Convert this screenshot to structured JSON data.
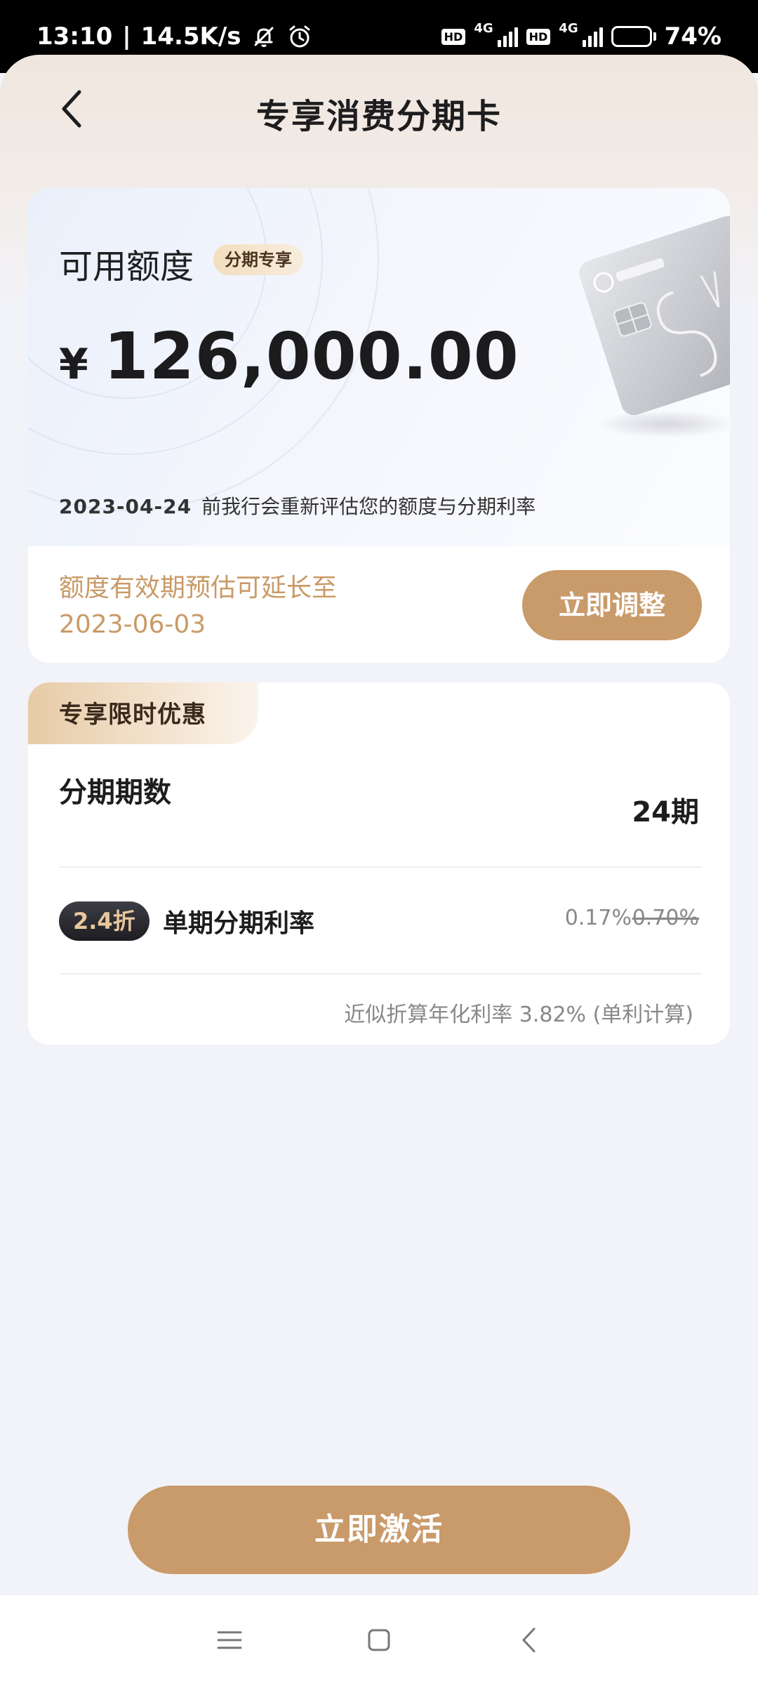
{
  "status_bar": {
    "time": "13:10",
    "separator": "|",
    "net_speed": "14.5K/s",
    "sim1_tag": "4G",
    "sim2_tag": "4G",
    "hd_label": "HD",
    "battery": "74%",
    "battery_level": 0.74
  },
  "header": {
    "title": "专享消费分期卡"
  },
  "credit": {
    "label": "可用额度",
    "badge": "分期专享",
    "currency": "¥",
    "amount": "126,000.00",
    "review_date": "2023-04-24",
    "review_text": "前我行会重新评估您的额度与分期利率",
    "validity_line1": "额度有效期预估可延长至",
    "validity_line2": "2023-06-03",
    "adjust_label": "立即调整"
  },
  "offer": {
    "tag": "专享限时优惠",
    "term_label": "分期期数",
    "term_value": "24期",
    "discount_badge": "2.4折",
    "rate_label": "单期分期利率",
    "rate_current": "0.17%",
    "rate_original": "0.70%",
    "annual_note": "近似折算年化利率 3.82% (单利计算)"
  },
  "cta": {
    "activate_label": "立即激活"
  },
  "colors": {
    "accent": "#c99a6a",
    "accent_text": "#c99a67",
    "background": "#f2f3f8"
  },
  "icons": {
    "back": "chevron-left-icon",
    "mute": "bell-off-icon",
    "alarm": "alarm-clock-icon",
    "nav_menu": "menu-icon",
    "nav_home": "square-icon",
    "nav_back": "chevron-left-icon"
  }
}
